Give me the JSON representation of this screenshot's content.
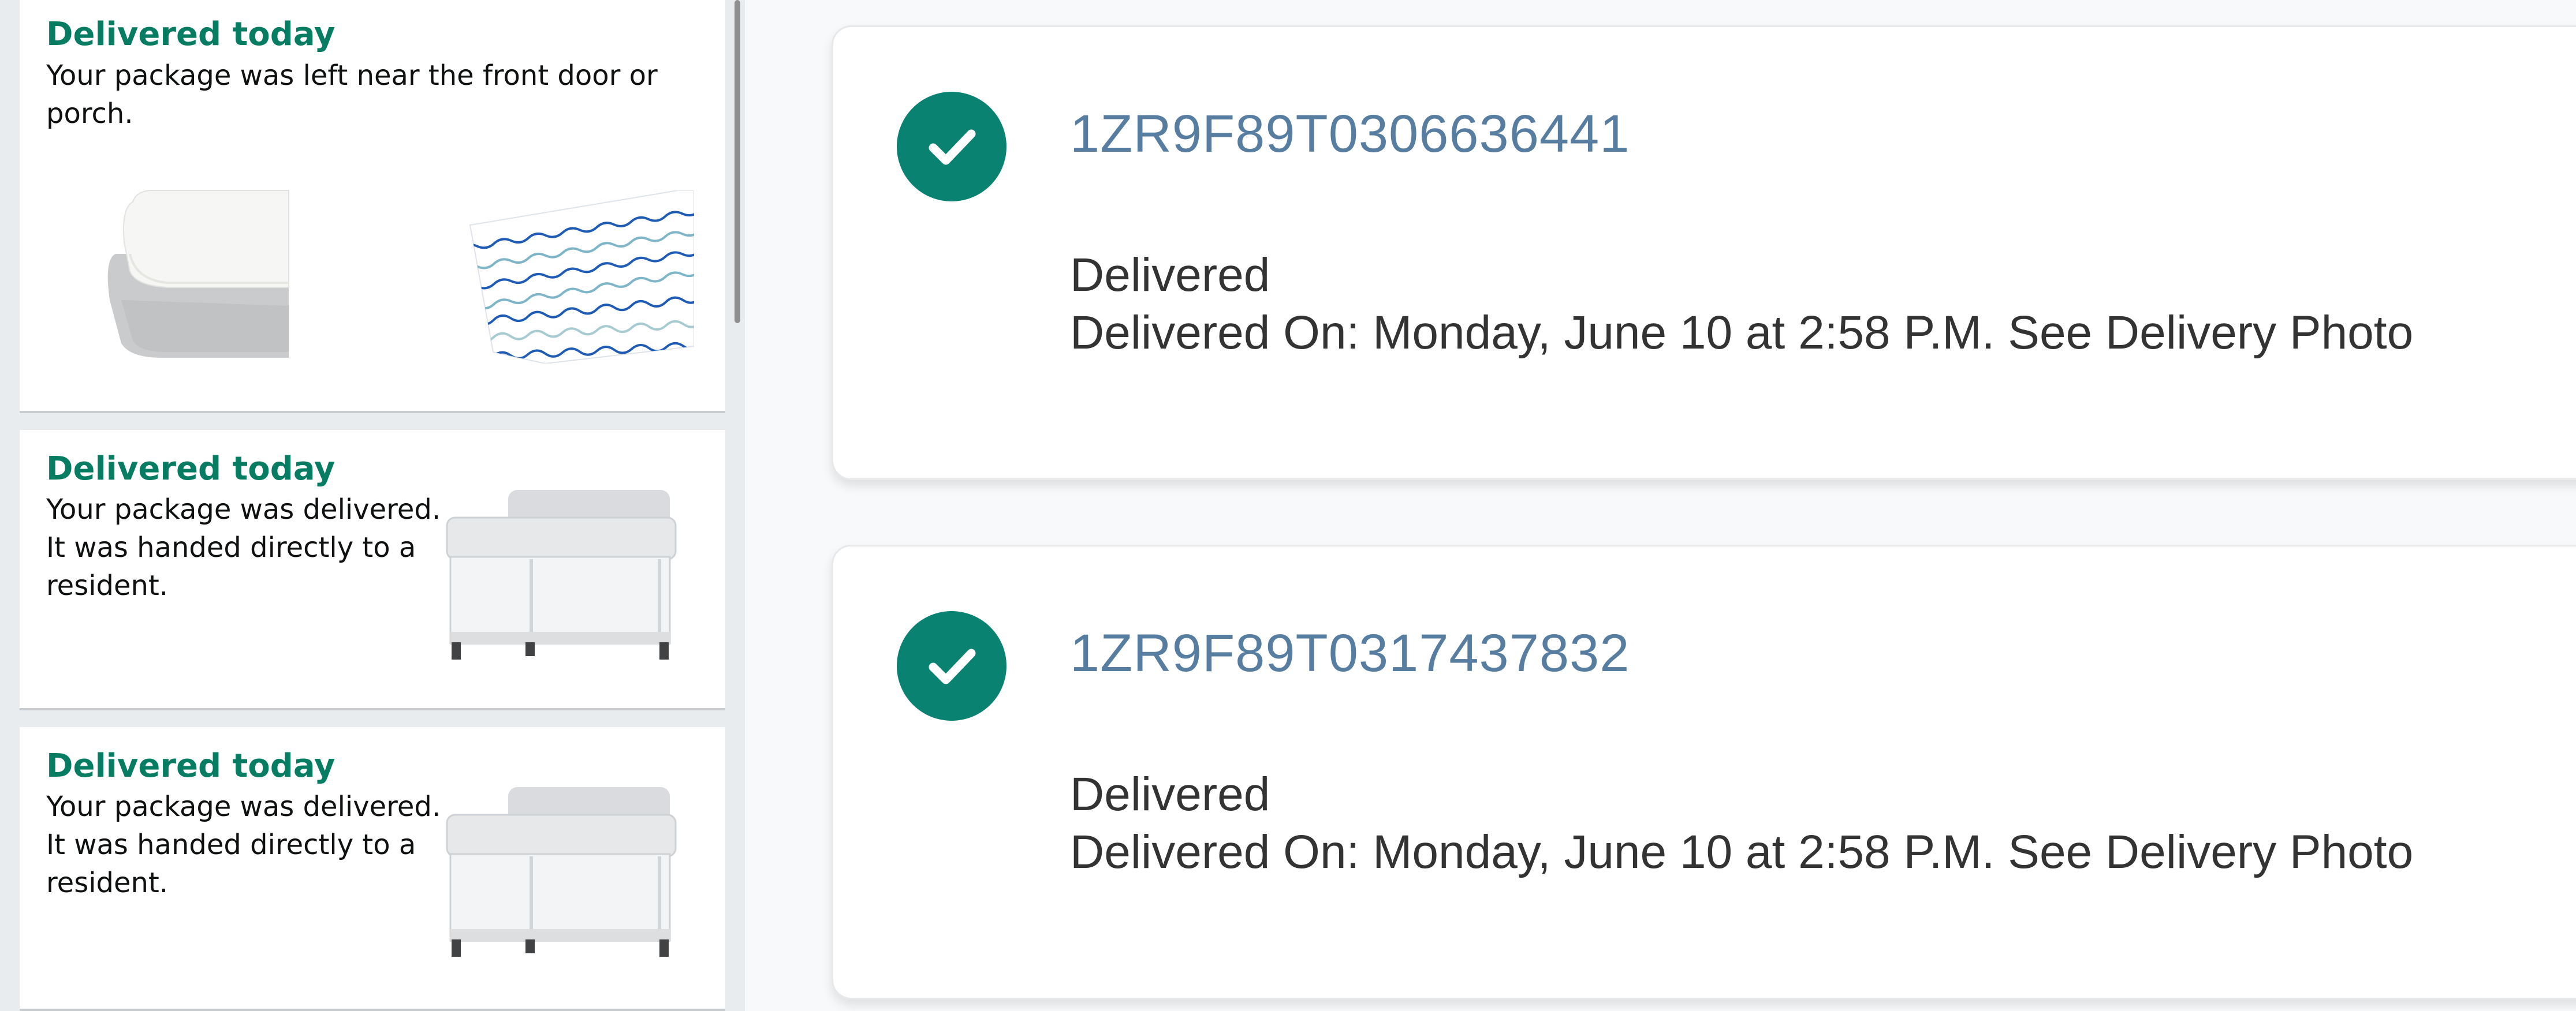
{
  "orders": [
    {
      "status": "Delivered today",
      "description": "Your package was left near the front door or porch.",
      "images": [
        "crib-sheets-white-gray",
        "crib-sheet-blue-wave"
      ]
    },
    {
      "status": "Delivered today",
      "description": "Your package was delivered. It was handed directly to a resident.",
      "images": [
        "gray-mesh-crib"
      ]
    },
    {
      "status": "Delivered today",
      "description": "Your package was delivered. It was handed directly to a resident.",
      "images": [
        "gray-mesh-crib"
      ]
    }
  ],
  "tracking": [
    {
      "number": "1ZR9F89T0306636441",
      "status": "Delivered",
      "delivered_on": "Delivered On: Monday, June 10 at 2:58 P.M.",
      "photo_link": "See Delivery Photo",
      "icon": "check-circle-icon"
    },
    {
      "number": "1ZR9F89T0317437832",
      "status": "Delivered",
      "delivered_on": "Delivered On: Monday, June 10 at 2:58 P.M.",
      "photo_link": "See Delivery Photo",
      "icon": "check-circle-icon"
    }
  ],
  "colors": {
    "status_green": "#067d62",
    "tracking_blue": "#577ea0",
    "badge_teal": "#0a8272",
    "page_bg": "#e9ecee"
  }
}
